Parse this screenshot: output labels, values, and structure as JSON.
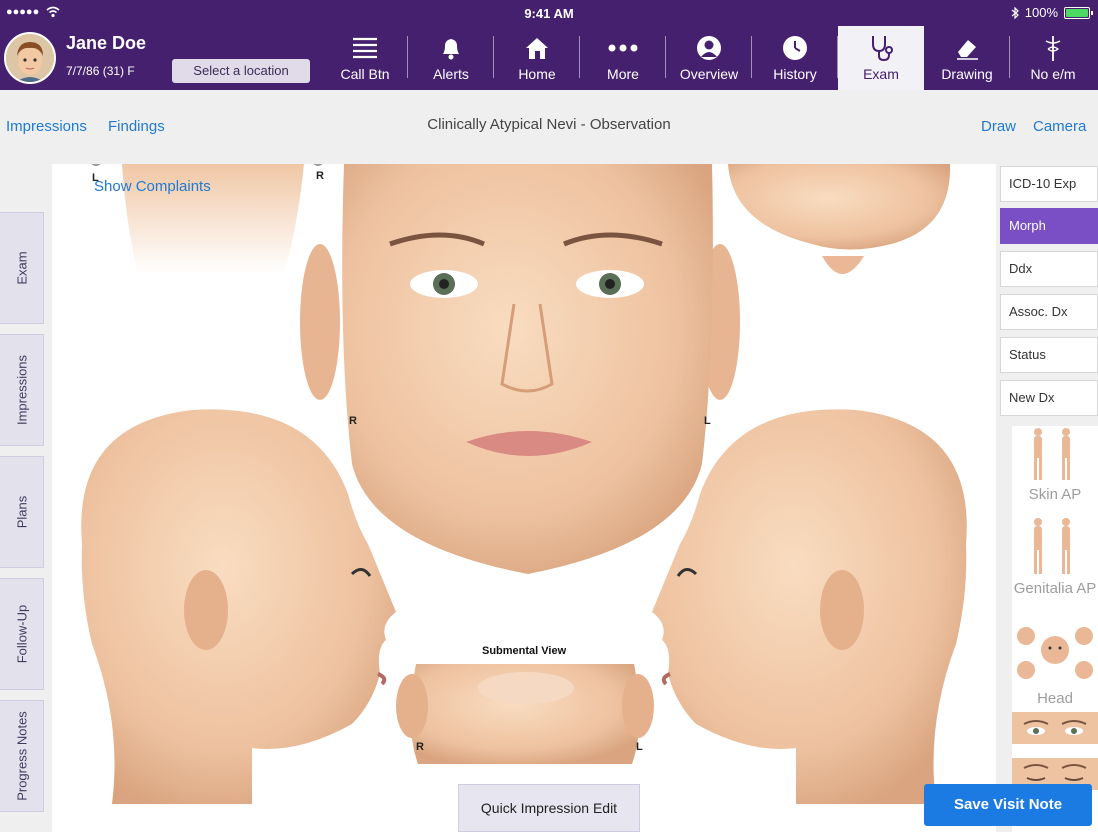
{
  "status_bar": {
    "signal": "●●●●●",
    "time": "9:41 AM",
    "battery": "100%",
    "battery_level": 1.0
  },
  "patient": {
    "name": "Jane Doe",
    "info": "7/7/86 (31) F",
    "location_button": "Select a location"
  },
  "nav": [
    {
      "label": "Call Btn",
      "icon": "list-icon"
    },
    {
      "label": "Alerts",
      "icon": "bell-icon"
    },
    {
      "label": "Home",
      "icon": "home-icon"
    },
    {
      "label": "More",
      "icon": "more-dots-icon"
    },
    {
      "label": "Overview",
      "icon": "person-circle-icon"
    },
    {
      "label": "History",
      "icon": "clock-icon"
    },
    {
      "label": "Exam",
      "icon": "stethoscope-icon",
      "active": true
    },
    {
      "label": "Drawing",
      "icon": "eraser-icon"
    },
    {
      "label": "No e/m",
      "icon": "em-caduceus-icon",
      "icon_text": "E M"
    }
  ],
  "toolbar": {
    "impressions": "Impressions",
    "findings": "Findings",
    "title": "Clinically Atypical Nevi - Observation",
    "draw": "Draw",
    "camera": "Camera"
  },
  "left_tabs": [
    "Exam",
    "Impressions",
    "Plans",
    "Follow-Up",
    "Progress Notes"
  ],
  "canvas": {
    "show_complaints": "Show Complaints",
    "submental_label": "Submental View",
    "mark_r": "R",
    "mark_l": "L"
  },
  "right_panel": {
    "buttons": [
      "ICD-10 Exp",
      "Morph",
      "Ddx",
      "Assoc. Dx",
      "Status",
      "New Dx"
    ],
    "active_button": "Morph",
    "thumbnails": [
      "Skin AP",
      "Genitalia AP",
      "Head"
    ]
  },
  "bottom": {
    "quick_impression": "Quick Impression Edit",
    "save": "Save Visit Note"
  },
  "colors": {
    "header": "#45206e",
    "accent": "#7a4ec4",
    "link": "#1f7ad1",
    "save": "#1b7be3",
    "skin": "#f0c9a6"
  }
}
